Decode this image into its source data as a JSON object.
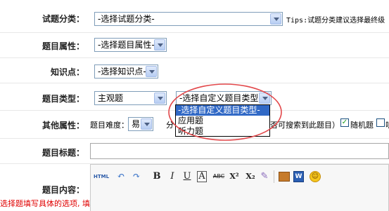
{
  "form": {
    "category": {
      "label": "试题分类：",
      "value": "-选择试题分类-",
      "tips": "Tips:试题分类建议选择最终级"
    },
    "attribute": {
      "label": "题目属性：",
      "value": "-选择题目属性-"
    },
    "knowledge": {
      "label": "知识点：",
      "value": "-选择知识点-"
    },
    "type": {
      "label": "题目类型：",
      "value": "主观题",
      "custom_value": "-选择自定义题目类型-",
      "options": [
        "-选择自定义题目类型-",
        "应用题",
        "听力题"
      ]
    },
    "other": {
      "label": "其他属性：",
      "difficulty_label": "题目难度：",
      "difficulty_value": "易",
      "text_partial_left": "分",
      "text_partial_right": "否可搜索到此题目）",
      "random_label": "随机题",
      "trailing_label": "听"
    },
    "title": {
      "label": "题目标题："
    },
    "content": {
      "label": "题目内容：",
      "note": "选择题填写具体的选项, 填"
    }
  },
  "toolbar": {
    "html": "HTML",
    "bold": "B",
    "italic": "I",
    "underline": "U",
    "font": "A",
    "strike": "ABC",
    "sup": "X²",
    "sub": "X₂"
  },
  "colors": {
    "annotation": "#e2474a",
    "highlight": "#3169c6",
    "note": "#e00000"
  }
}
